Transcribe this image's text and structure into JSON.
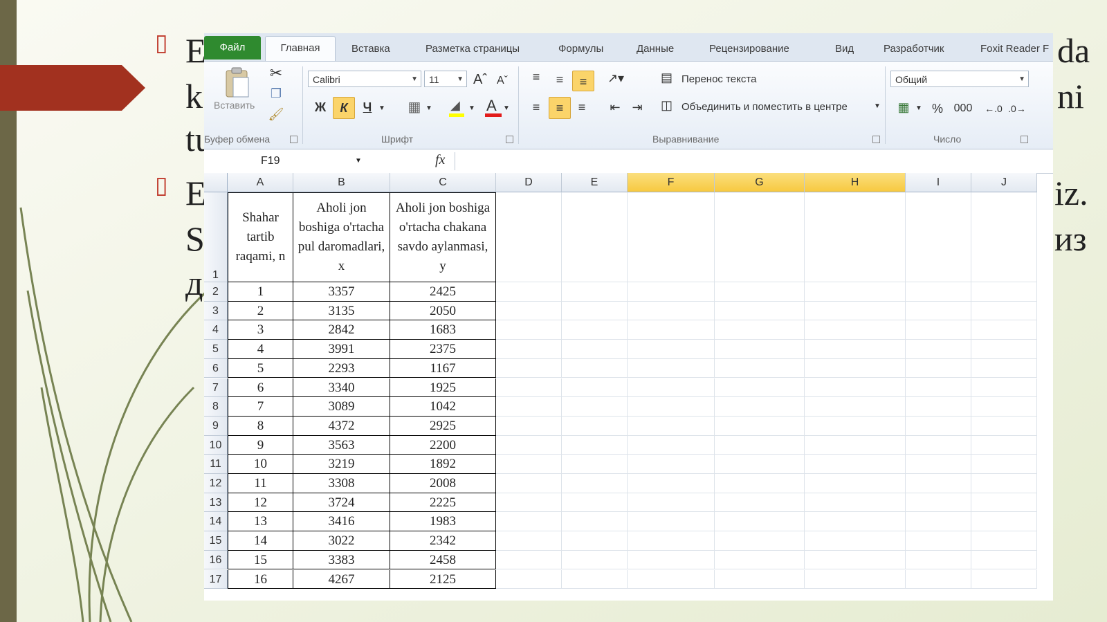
{
  "slide": {
    "bullet_glyph": "▯",
    "fragments": [
      "E",
      "da",
      "k",
      "ni",
      "tu",
      "E",
      "iz.",
      "S",
      "из",
      "д"
    ]
  },
  "tabs": {
    "file": "Файл",
    "active": "Главная",
    "items": [
      "Вставка",
      "Разметка страницы",
      "Формулы",
      "Данные",
      "Рецензирование",
      "Вид",
      "Разработчик",
      "Foxit Reader F"
    ]
  },
  "ribbon": {
    "paste": "Вставить",
    "font_name": "Calibri",
    "font_size": "11",
    "bold": "Ж",
    "italic": "К",
    "underline": "Ч",
    "wrap_text": "Перенос текста",
    "merge_center": "Объединить и поместить в центре",
    "number_format": "Общий",
    "percent": "%",
    "thousands": "000",
    "groups": {
      "clipboard": "Буфер обмена",
      "font": "Шрифт",
      "alignment": "Выравнивание",
      "number": "Число"
    }
  },
  "formula_bar": {
    "cell_ref": "F19",
    "fx": "fx",
    "value": ""
  },
  "sheet": {
    "columns": [
      "A",
      "B",
      "C",
      "D",
      "E",
      "F",
      "G",
      "H",
      "I",
      "J"
    ],
    "selected_columns": [
      "F",
      "G",
      "H"
    ],
    "header_row": {
      "A": "Shahar tartib raqami, n",
      "B": "Aholi jon boshiga o'rtacha pul daromadlari, x",
      "C": "Aholi jon boshiga o'rtacha chakana savdo aylanmasi, y"
    },
    "rows": [
      [
        "1",
        "3357",
        "2425"
      ],
      [
        "2",
        "3135",
        "2050"
      ],
      [
        "3",
        "2842",
        "1683"
      ],
      [
        "4",
        "3991",
        "2375"
      ],
      [
        "5",
        "2293",
        "1167"
      ],
      [
        "6",
        "3340",
        "1925"
      ],
      [
        "7",
        "3089",
        "1042"
      ],
      [
        "8",
        "4372",
        "2925"
      ],
      [
        "9",
        "3563",
        "2200"
      ],
      [
        "10",
        "3219",
        "1892"
      ],
      [
        "11",
        "3308",
        "2008"
      ],
      [
        "12",
        "3724",
        "2225"
      ],
      [
        "13",
        "3416",
        "1983"
      ],
      [
        "14",
        "3022",
        "2342"
      ],
      [
        "15",
        "3383",
        "2458"
      ],
      [
        "16",
        "4267",
        "2125"
      ]
    ],
    "row_numbers": [
      "1",
      "2",
      "3",
      "4",
      "5",
      "6",
      "7",
      "8",
      "9",
      "10",
      "11",
      "12",
      "13",
      "14",
      "15",
      "16",
      "17"
    ]
  }
}
